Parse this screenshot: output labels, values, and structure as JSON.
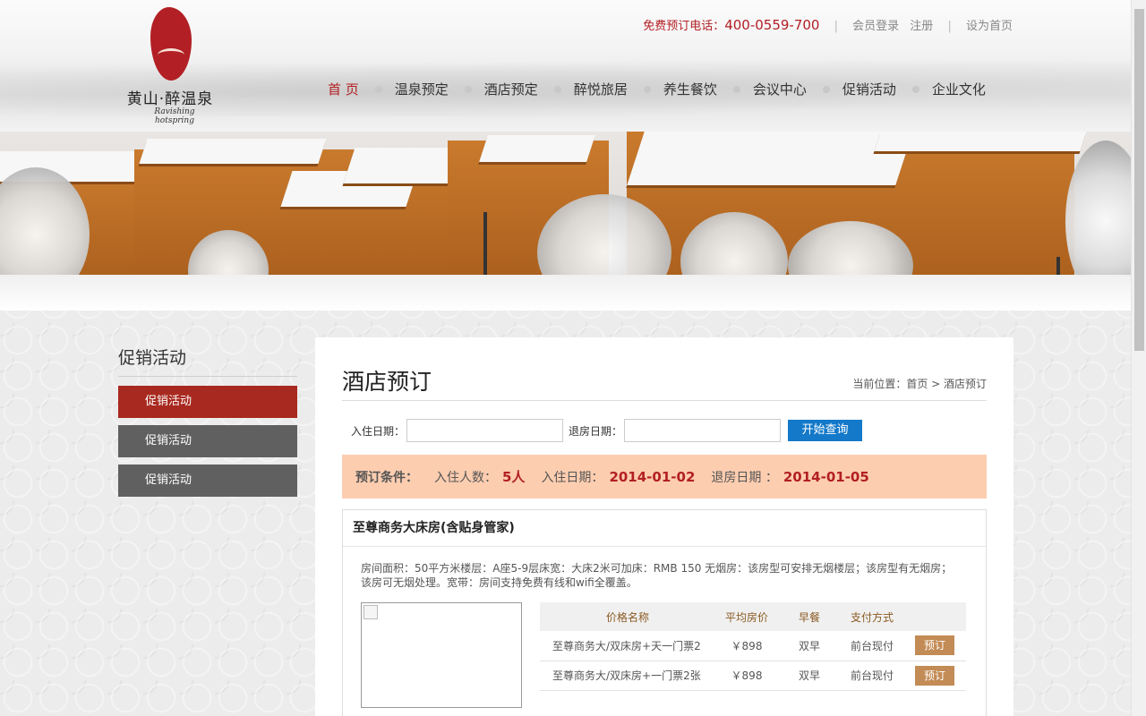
{
  "header": {
    "logo_name": "黄山·醉温泉",
    "logo_sub": "Ravishing hotspring",
    "phone_label": "免费预订电话：",
    "phone": "400-0559-700",
    "sep": "|",
    "links": [
      "会员登录",
      "注册",
      "设为首页"
    ]
  },
  "nav": [
    "首 页",
    "温泉预定",
    "酒店预定",
    "醉悦旅居",
    "养生餐饮",
    "会议中心",
    "促销活动",
    "企业文化"
  ],
  "sidebar": {
    "title": "促销活动",
    "items": [
      "促销活动",
      "促销活动",
      "促销活动"
    ]
  },
  "main": {
    "title": "酒店预订",
    "breadcrumb": "当前位置：首页 > 酒店预订",
    "search": {
      "checkin_label": "入住日期：",
      "checkout_label": "退房日期：",
      "checkin_value": "",
      "checkout_value": "",
      "button": "开始查询"
    },
    "conditions": {
      "label": "预订条件：",
      "guests_label": "入住人数：",
      "guests": "5人",
      "checkin_label": "入住日期：",
      "checkin": "2014-01-02",
      "checkout_label": "退房日期 ：",
      "checkout": "2014-01-05"
    },
    "room": {
      "title": "至尊商务大床房(含贴身管家)",
      "description": "房间面积：50平方米楼层：A座5-9层床宽：大床2米可加床：RMB 150 无烟房：该房型可安排无烟楼层；该房型有无烟房；该房可无烟处理。宽带：房间支持免费有线和wifi全覆盖。",
      "table_headers": [
        "价格名称",
        "平均房价",
        "早餐",
        "支付方式",
        ""
      ],
      "rates": [
        {
          "name": "至尊商务大/双床房+天一门票2",
          "price": "￥898",
          "breakfast": "双早",
          "payment": "前台现付",
          "action": "预订"
        },
        {
          "name": "至尊商务大/双床房+一门票2张",
          "price": "￥898",
          "breakfast": "双早",
          "payment": "前台现付",
          "action": "预订"
        }
      ]
    }
  }
}
